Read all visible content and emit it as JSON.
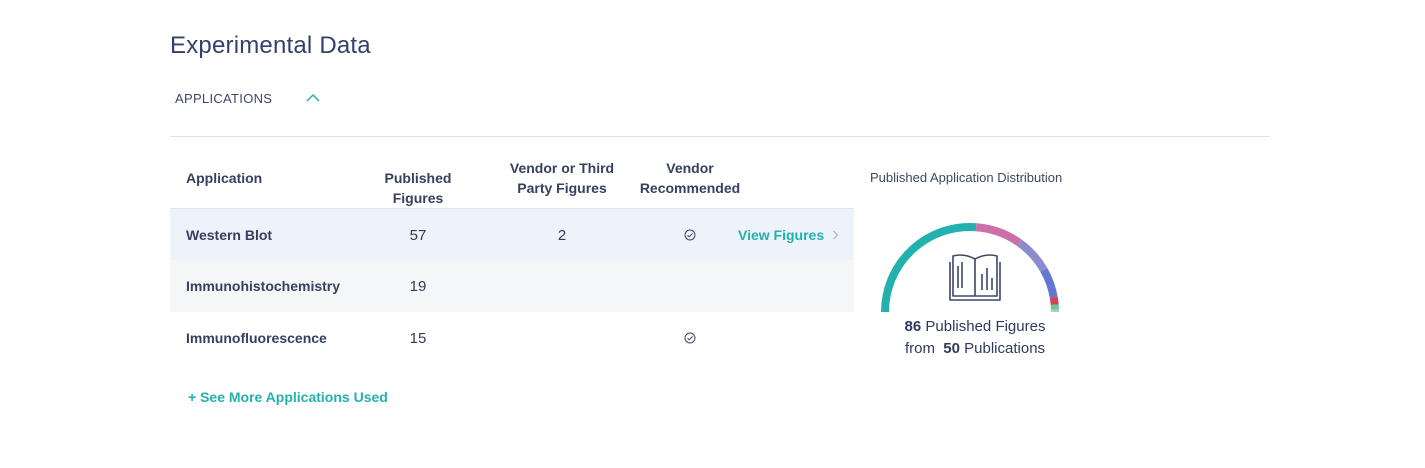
{
  "section": {
    "title": "Experimental Data"
  },
  "accordion": {
    "label": "APPLICATIONS",
    "expanded": true
  },
  "table": {
    "headers": {
      "application": "Application",
      "published": "Published Figures",
      "vendor_line1": "Vendor or Third",
      "vendor_line2": "Party Figures",
      "recommended_line1": "Vendor",
      "recommended_line2": "Recommended"
    },
    "rows": [
      {
        "application": "Western Blot",
        "published": "57",
        "vendor": "2",
        "recommended": true,
        "view_label": "View Figures"
      },
      {
        "application": "Immunohistochemistry",
        "published": "19",
        "vendor": "",
        "recommended": false,
        "view_label": ""
      },
      {
        "application": "Immunofluorescence",
        "published": "15",
        "vendor": "",
        "recommended": true,
        "view_label": ""
      }
    ],
    "see_more": "+ See More Applications Used"
  },
  "distribution": {
    "title": "Published Application Distribution",
    "total_figures": "86",
    "figures_label": "Published Figures",
    "from_label": "from",
    "publications": "50",
    "publications_label": "Publications",
    "segments": [
      {
        "value": 57,
        "color": "#22b1ad"
      },
      {
        "value": 19,
        "color": "#cc6fa8"
      },
      {
        "value": 15,
        "color": "#8c8ccc"
      },
      {
        "value": 12,
        "color": "#6577cf"
      },
      {
        "value": 3,
        "color": "#d0435c"
      },
      {
        "value": 2,
        "color": "#5dd08f"
      },
      {
        "value": 1,
        "color": "#b9c4d3"
      }
    ],
    "icon": "open-book-chart-icon"
  },
  "colors": {
    "accent": "#22b1ad",
    "text": "#2f3a5c",
    "highlight_row": "#eef2fa"
  }
}
